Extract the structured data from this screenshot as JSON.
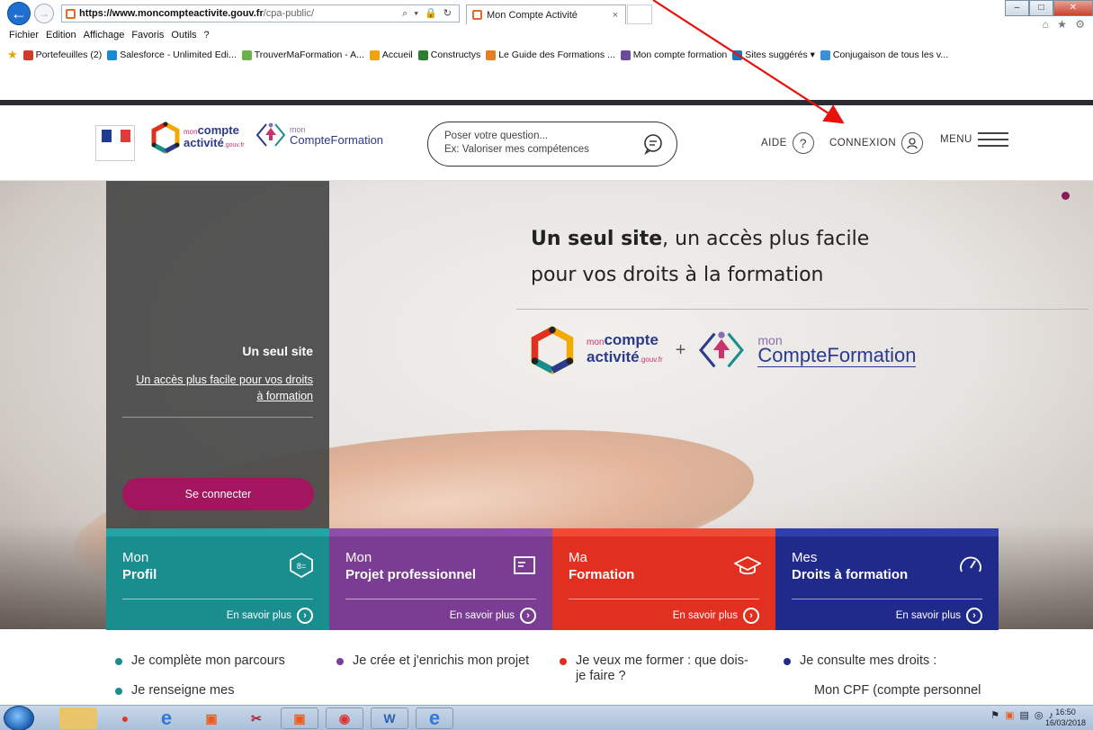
{
  "browser": {
    "url_host": "https://www.moncompteactivite.gouv.fr",
    "url_path": "/cpa-public/",
    "addr_controls": "⌕ ▾ 🔒 ↻",
    "tab_title": "Mon Compte Activité",
    "tab_close": "×",
    "win_min": "–",
    "win_max": "□",
    "win_close": "✕",
    "toolbar_icons": "⌂ ★ ⚙",
    "menu": [
      "Fichier",
      "Edition",
      "Affichage",
      "Favoris",
      "Outils",
      "?"
    ],
    "favorites": [
      {
        "label": "Portefeuilles (2)",
        "color": "#d23b2a"
      },
      {
        "label": "Salesforce - Unlimited Edi...",
        "color": "#1a8ad4"
      },
      {
        "label": "TrouverMaFormation - A...",
        "color": "#6ab04c"
      },
      {
        "label": "Accueil",
        "color": "#f0a30a"
      },
      {
        "label": "Constructys",
        "color": "#2e7d32"
      },
      {
        "label": "Le Guide des Formations ...",
        "color": "#e67e22"
      },
      {
        "label": "Mon compte formation",
        "color": "#6a4c9c"
      },
      {
        "label": "Sites suggérés ▾",
        "color": "#1e73be"
      },
      {
        "label": "Conjugaison de tous les v...",
        "color": "#3a8fd6"
      }
    ]
  },
  "header": {
    "search_line1": "Poser votre question...",
    "search_line2": "Ex: Valoriser mes compétences",
    "aide": "AIDE",
    "aide_icon": "?",
    "connexion": "CONNEXION",
    "menu": "MENU",
    "cpa_word1": "compte",
    "cpa_word1_prefix": "mon",
    "cpa_word2": "activité",
    "cpa_word2_suffix": ".gouv.fr",
    "cf_word1": "mon",
    "cf_word2": "CompteFormation"
  },
  "hero": {
    "panel_title": "Un seul site",
    "panel_link": "Un accès plus facile pour vos droits à formation",
    "connect_button": "Se connecter",
    "headline_bold": "Un seul site",
    "headline_rest": ", un accès plus facile",
    "headline_line2": "pour vos droits à la formation",
    "plus": "+"
  },
  "cards": [
    {
      "line1": "Mon",
      "line2": "Profil",
      "more": "En savoir plus",
      "color": "#1a8d8f",
      "bar": "#26a3a5"
    },
    {
      "line1": "Mon",
      "line2": "Projet professionnel",
      "more": "En savoir plus",
      "color": "#7b3d93",
      "bar": "#8e4fa8"
    },
    {
      "line1": "Ma",
      "line2": "Formation",
      "more": "En savoir plus",
      "color": "#e1301f",
      "bar": "#ef4a36"
    },
    {
      "line1": "Mes",
      "line2": "Droits à formation",
      "more": "En savoir plus",
      "color": "#1f2a8a",
      "bar": "#3140a8"
    }
  ],
  "bullets": [
    {
      "items": [
        "Je complète mon parcours",
        "Je renseigne mes"
      ],
      "color": "#1a8d8f"
    },
    {
      "items": [
        "Je crée et j'enrichis mon projet"
      ],
      "color": "#7b3d93"
    },
    {
      "items": [
        "Je veux me former : que dois-je faire ?"
      ],
      "color": "#e1301f"
    },
    {
      "items": [
        "Je consulte mes droits :"
      ],
      "color": "#1f2a8a",
      "extra": "Mon CPF (compte personnel"
    }
  ],
  "taskbar": {
    "clock_time": "16:50",
    "clock_date": "16/03/2018"
  }
}
